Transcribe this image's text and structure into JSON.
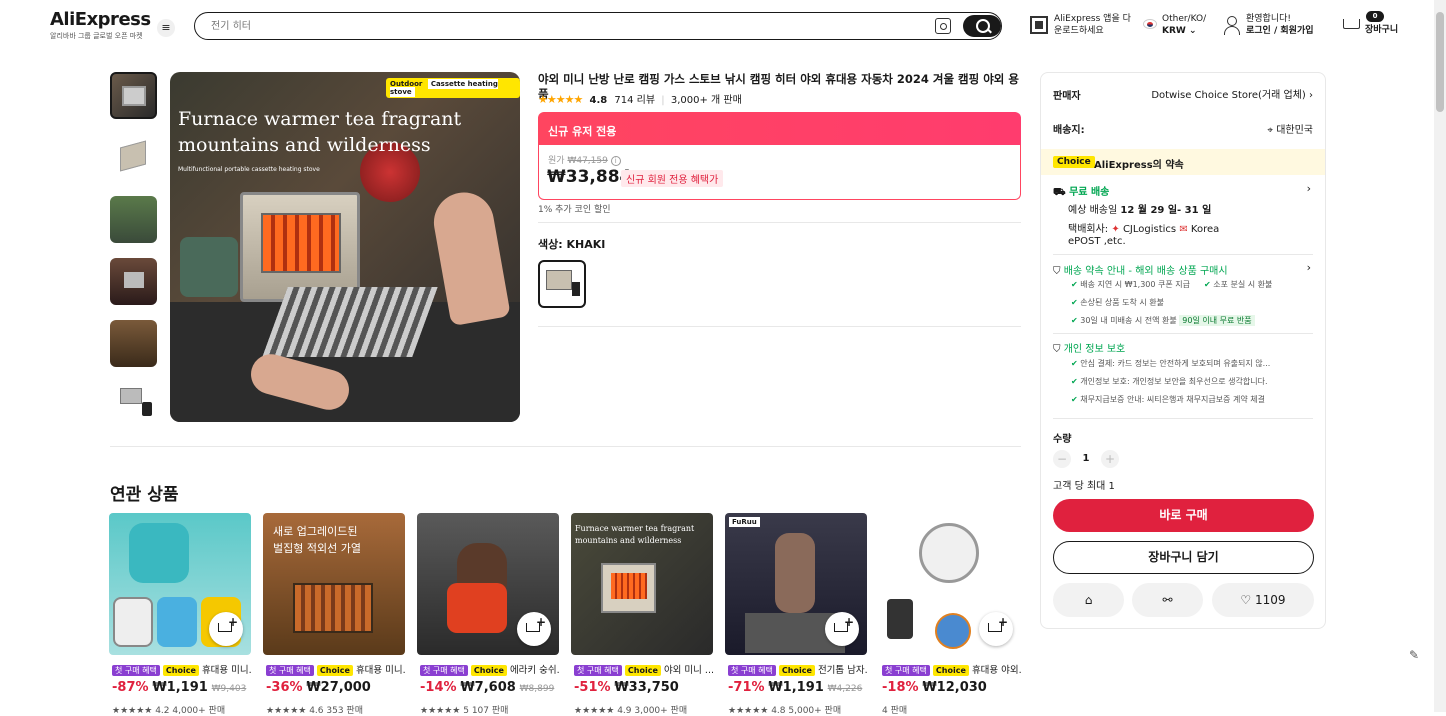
{
  "header": {
    "logo": "AliExpress",
    "logo_sub": "알리바바 그룹 글로벌 오픈 마켓",
    "search_placeholder": "전기 히터",
    "app_line1": "AliExpress 앱을 다",
    "app_line2": "운로드하세요",
    "locale_line1": "Other/KO/",
    "locale_line2": "KRW",
    "welcome": "환영합니다!",
    "login": "로그인 / 회원가입",
    "cart_count": "0",
    "cart_label": "장바구니"
  },
  "product": {
    "title": "야외 미니 난방 난로 캠핑 가스 스토브 낚시 캠핑 히터 야외 휴대용 자동차 2024 겨울 캠핑 야외 용품",
    "stars": "★★★★★",
    "rating": "4.8",
    "reviews": "714 리뷰",
    "sold": "3,000+ 개 판매",
    "promo_label": "신규 유저 전용",
    "orig_price_label": "원가",
    "orig_price": "₩47,159",
    "price": "₩33,884",
    "price_tag": "신규 회원 전용 혜택가",
    "coin_discount": "1% 추가 코인 할인",
    "color_label": "색상: KHAKI",
    "image_tag1": "Outdoor",
    "image_tag2": "Cassette heating stove",
    "image_headline1": "Furnace warmer tea fragrant",
    "image_headline2": "mountains and wilderness",
    "image_sub": "Multifunctional portable cassette heating stove"
  },
  "seller": {
    "label": "판매자",
    "name": "Dotwise Choice Store(거래 업체)",
    "ship_label": "배송지:",
    "ship_to": "대한민국",
    "choice": "Choice",
    "promise": "AliExpress의 약속",
    "free_ship": "무료 배송",
    "eta_prefix": "예상 배송일",
    "eta": "12 월 29 일- 31 일",
    "carrier_prefix": "택배회사:",
    "carrier1": "CJLogistics",
    "carrier2": "Korea",
    "carrier3": "ePOST ,etc.",
    "guarantee_title": "배송 약속 안내 - 해외 배송 상품 구매시",
    "g1": "배송 지연 시 ₩1,300 쿠폰 지급",
    "g2": "소포 분실 시 환불",
    "g3": "손상된 상품 도착 시 환불",
    "g4": "30일 내 미배송 시 전액 환불",
    "g4_badge": "90일 이내 무료 반품",
    "privacy_title": "개인 정보 보호",
    "p1": "안심 결제: 카드 정보는 안전하게 보호되며 유출되지 않...",
    "p2": "개인정보 보호: 개인정보 보안을 최우선으로 생각합니다.",
    "p3": "채무지급보증 안내: 씨티은행과 채무지급보증 계약 체결",
    "qty_label": "수량",
    "qty": "1",
    "qty_limit": "고객 당 최대 1",
    "buy_now": "바로 구매",
    "add_cart": "장바구니 담기",
    "wish_count": "1109"
  },
  "related": {
    "title": "연관 상품",
    "items": [
      {
        "tag": "첫 구매 혜택",
        "choice": "Choice",
        "name": "휴대용 미니...",
        "disc": "-87%",
        "price": "₩1,191",
        "orig": "₩9,403",
        "rating": "★★★★★ 4.2",
        "sold": "4,000+ 판매"
      },
      {
        "tag": "첫 구매 혜택",
        "choice": "Choice",
        "name": "휴대용 미니...",
        "disc": "-36%",
        "price": "₩27,000",
        "orig": "",
        "rating": "★★★★★ 4.6",
        "sold": "353 판매"
      },
      {
        "tag": "첫 구매 혜택",
        "choice": "Choice",
        "name": "에라키 숭쉬...",
        "disc": "-14%",
        "price": "₩7,608",
        "orig": "₩8,899",
        "rating": "★★★★★ 5",
        "sold": "107 판매"
      },
      {
        "tag": "첫 구매 혜택",
        "choice": "Choice",
        "name": "야외 미니 ...",
        "disc": "-51%",
        "price": "₩33,750",
        "orig": "",
        "rating": "★★★★★ 4.9",
        "sold": "3,000+ 판매"
      },
      {
        "tag": "첫 구매 혜택",
        "choice": "Choice",
        "name": "전기톱 남자...",
        "disc": "-71%",
        "price": "₩1,191",
        "orig": "₩4,226",
        "rating": "★★★★★ 4.8",
        "sold": "5,000+ 판매"
      },
      {
        "tag": "첫 구매 혜택",
        "choice": "Choice",
        "name": "휴대용 야외...",
        "disc": "-18%",
        "price": "₩12,030",
        "orig": "",
        "rating": "",
        "sold": "4 판매"
      }
    ],
    "card2_text1": "새로 업그레이드된",
    "card2_text2": "벌집형 적외선 가열",
    "card4_text1": "Furnace warmer tea fragrant",
    "card4_text2": "mountains and wilderness",
    "card5_brand": "FuRuu"
  }
}
